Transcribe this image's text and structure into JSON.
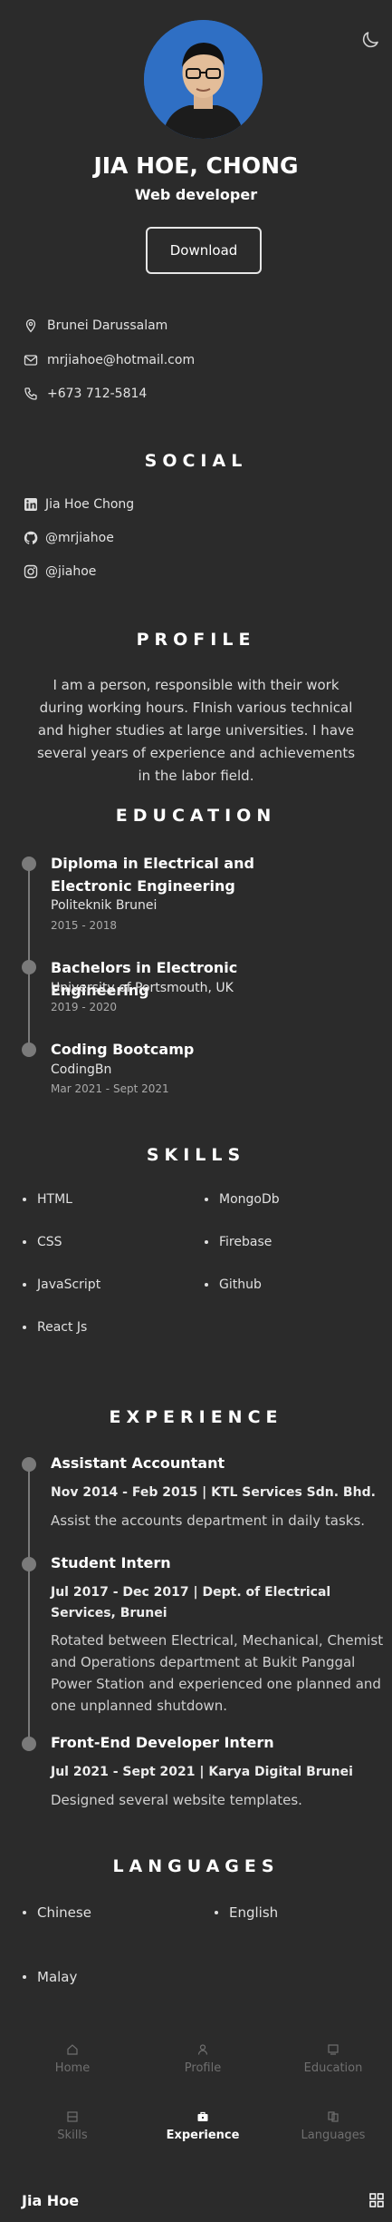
{
  "header": {
    "name": "JIA HOE, CHONG",
    "role": "Web developer",
    "download_label": "Download",
    "avatar_bg": "#2f6fc4"
  },
  "contact": {
    "location": "Brunei Darussalam",
    "email": "mrjiahoe@hotmail.com",
    "phone": "+673 712-5814"
  },
  "social": {
    "title": "SOCIAL",
    "items": [
      {
        "icon": "linkedin-icon",
        "label": "Jia Hoe Chong"
      },
      {
        "icon": "github-icon",
        "label": "@mrjiahoe"
      },
      {
        "icon": "instagram-icon",
        "label": "@jiahoe"
      }
    ]
  },
  "profile": {
    "title": "PROFILE",
    "text": "I am a person, responsible with their work during working hours. FInish various technical and higher studies at large universities. I have several years of experience and achievements in the labor field."
  },
  "education": {
    "title": "EDUCATION",
    "items": [
      {
        "title": "Diploma in Electrical and Electronic Engineering",
        "school": "Politeknik Brunei",
        "date": "2015 - 2018"
      },
      {
        "title": "Bachelors in Electronic Engineering",
        "school": "University of Portsmouth, UK",
        "date": "2019 - 2020"
      },
      {
        "title": "Coding Bootcamp",
        "school": "CodingBn",
        "date": "Mar 2021 - Sept 2021"
      }
    ]
  },
  "skills": {
    "title": "SKILLS",
    "items": [
      "HTML",
      "MongoDb",
      "CSS",
      "Firebase",
      "JavaScript",
      "Github",
      "React Js"
    ]
  },
  "experience": {
    "title": "EXPERIENCE",
    "items": [
      {
        "title": "Assistant Accountant",
        "meta": "Nov 2014 - Feb 2015 | KTL Services Sdn. Bhd.",
        "desc": "Assist the accounts department in daily tasks."
      },
      {
        "title": "Student Intern",
        "meta": "Jul 2017 - Dec 2017 | Dept. of Electrical Services, Brunei",
        "desc": "Rotated between Electrical, Mechanical, Chemist and Operations department at Bukit Panggal Power Station and experienced one planned and one unplanned shutdown."
      },
      {
        "title": "Front-End Developer Intern",
        "meta": "Jul 2021 - Sept 2021 | Karya Digital Brunei",
        "desc": "Designed several website templates."
      }
    ]
  },
  "languages": {
    "title": "LANGUAGES",
    "items": [
      "Chinese",
      "English",
      "Malay"
    ]
  },
  "nav": {
    "items": [
      {
        "label": "Home",
        "icon": "home-icon",
        "active": false
      },
      {
        "label": "Profile",
        "icon": "user-icon",
        "active": false
      },
      {
        "label": "Education",
        "icon": "education-icon",
        "active": false
      },
      {
        "label": "Skills",
        "icon": "skills-icon",
        "active": false
      },
      {
        "label": "Experience",
        "icon": "briefcase-icon",
        "active": true
      },
      {
        "label": "Languages",
        "icon": "languages-icon",
        "active": false
      }
    ]
  },
  "footer": {
    "brand": "Jia Hoe"
  }
}
